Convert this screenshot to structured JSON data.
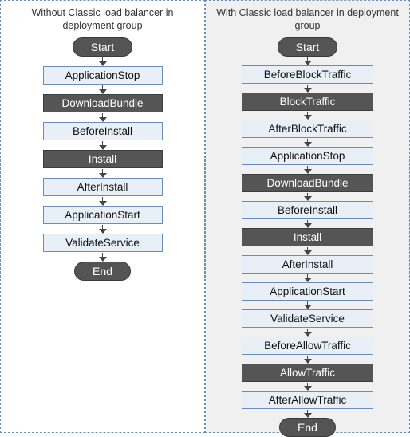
{
  "left": {
    "title": "Without Classic load balancer in deployment group",
    "start": "Start",
    "end": "End",
    "steps": [
      {
        "label": "ApplicationStop",
        "dark": false
      },
      {
        "label": "DownloadBundle",
        "dark": true
      },
      {
        "label": "BeforeInstall",
        "dark": false
      },
      {
        "label": "Install",
        "dark": true
      },
      {
        "label": "AfterInstall",
        "dark": false
      },
      {
        "label": "ApplicationStart",
        "dark": false
      },
      {
        "label": "ValidateService",
        "dark": false
      }
    ]
  },
  "right": {
    "title": "With Classic load balancer in deployment group",
    "start": "Start",
    "end": "End",
    "steps": [
      {
        "label": "BeforeBlockTraffic",
        "dark": false
      },
      {
        "label": "BlockTraffic",
        "dark": true
      },
      {
        "label": "AfterBlockTraffic",
        "dark": false
      },
      {
        "label": "ApplicationStop",
        "dark": false
      },
      {
        "label": "DownloadBundle",
        "dark": true
      },
      {
        "label": "BeforeInstall",
        "dark": false
      },
      {
        "label": "Install",
        "dark": true
      },
      {
        "label": "AfterInstall",
        "dark": false
      },
      {
        "label": "ApplicationStart",
        "dark": false
      },
      {
        "label": "ValidateService",
        "dark": false
      },
      {
        "label": "BeforeAllowTraffic",
        "dark": false
      },
      {
        "label": "AllowTraffic",
        "dark": true
      },
      {
        "label": "AfterAllowTraffic",
        "dark": false
      }
    ]
  }
}
